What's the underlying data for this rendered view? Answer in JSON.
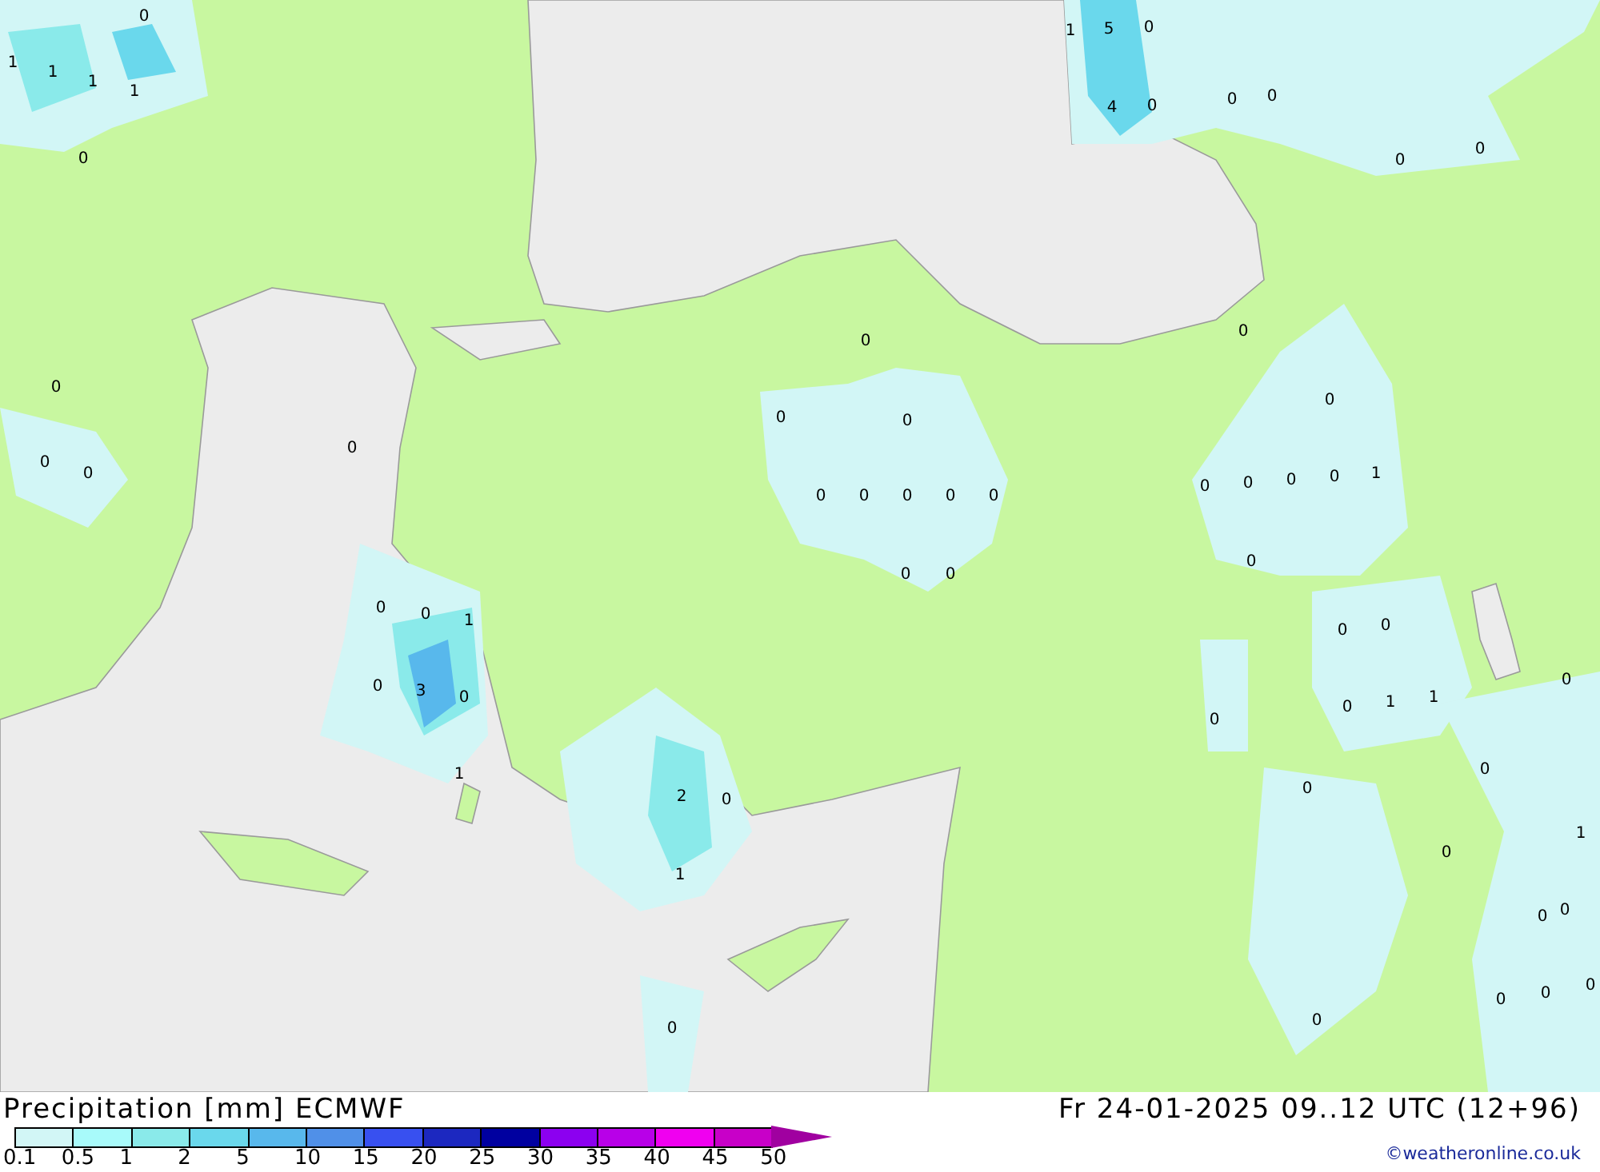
{
  "map": {
    "value_labels": [
      "0",
      "1",
      "1",
      "1",
      "1",
      "0",
      "1",
      "5",
      "0",
      "4",
      "0",
      "0",
      "0",
      "0",
      "0",
      "0",
      "0",
      "0",
      "0",
      "0",
      "0",
      "0",
      "0",
      "0",
      "0",
      "0",
      "0",
      "0",
      "0",
      "0",
      "0",
      "0",
      "0",
      "1",
      "0",
      "0",
      "0",
      "0",
      "0",
      "1",
      "0",
      "0",
      "0",
      "3",
      "0",
      "0",
      "0",
      "0",
      "1",
      "1",
      "1",
      "0",
      "0",
      "2",
      "0",
      "1",
      "0",
      "1",
      "0",
      "0",
      "0",
      "0",
      "0",
      "0",
      "0"
    ]
  },
  "legend": {
    "title": "Precipitation [mm] ECMWF",
    "scale": [
      {
        "label": "0.1",
        "color": "#d2f6f6"
      },
      {
        "label": "0.5",
        "color": "#a8fafa"
      },
      {
        "label": "1",
        "color": "#8aeaea"
      },
      {
        "label": "2",
        "color": "#6ad8ec"
      },
      {
        "label": "5",
        "color": "#58b8ec"
      },
      {
        "label": "10",
        "color": "#5090e8"
      },
      {
        "label": "15",
        "color": "#3850f0"
      },
      {
        "label": "20",
        "color": "#1c28c0"
      },
      {
        "label": "25",
        "color": "#0000a0"
      },
      {
        "label": "30",
        "color": "#8c00f0"
      },
      {
        "label": "35",
        "color": "#b800e8"
      },
      {
        "label": "40",
        "color": "#f000f0"
      },
      {
        "label": "45",
        "color": "#c800c8"
      }
    ],
    "end_label": "50"
  },
  "valid_time": "Fr 24-01-2025 09..12 UTC (12+96)",
  "credit": "©weatheronline.co.uk"
}
